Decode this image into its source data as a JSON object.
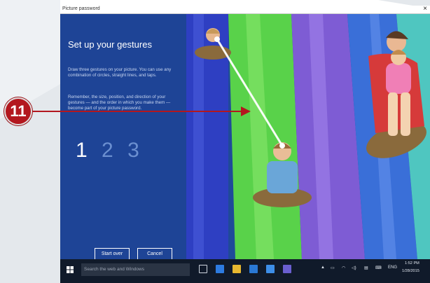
{
  "window": {
    "title": "Picture password",
    "close_glyph": "×"
  },
  "panel": {
    "heading": "Set up your gestures",
    "para1": "Draw three gestures on your picture. You can use any combination of circles, straight lines, and taps.",
    "para2": "Remember, the size, position, and direction of your gestures — and the order in which you make them — become part of your picture password.",
    "steps": [
      "1",
      "2",
      "3"
    ],
    "start_over_label": "Start over",
    "cancel_label": "Cancel"
  },
  "callout": {
    "number": "11"
  },
  "taskbar": {
    "search_placeholder": "Search the web and Windows",
    "language": "ENG",
    "time": "1:52 PM",
    "date": "1/28/2015"
  },
  "colors": {
    "panel_blue": "#1e4496",
    "callout_red": "#b3171e",
    "taskbar_dark": "#101a2a"
  }
}
